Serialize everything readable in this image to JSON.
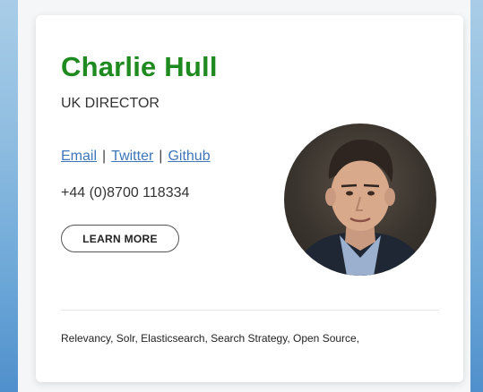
{
  "profile": {
    "name": "Charlie Hull",
    "role": "UK DIRECTOR",
    "links": {
      "email": "Email",
      "twitter": "Twitter",
      "github": "Github",
      "separator": "|"
    },
    "phone": "+44 (0)8700 118334",
    "learn_more_label": "LEARN MORE",
    "tags": "Relevancy, Solr, Elasticsearch, Search Strategy, Open Source,"
  },
  "colors": {
    "name": "#1f8a1f",
    "link": "#3f76b8",
    "text": "#333333"
  }
}
